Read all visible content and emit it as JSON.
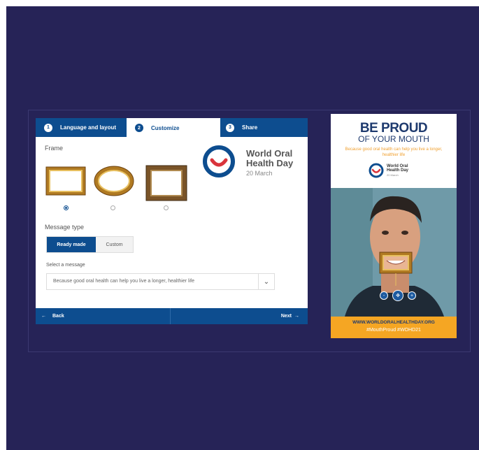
{
  "steps": [
    {
      "num": "1",
      "label": "Language and layout"
    },
    {
      "num": "2",
      "label": "Customize"
    },
    {
      "num": "3",
      "label": "Share"
    }
  ],
  "active_step": "Customize",
  "frame_section": {
    "label": "Frame",
    "options": [
      "rectangle-gold-frame",
      "oval-gold-frame",
      "square-bronze-frame"
    ],
    "selected_index": 0
  },
  "brand": {
    "title": "World Oral Health Day",
    "date": "20 March",
    "accent": "#0d4d8f",
    "logo_red": "#d9343c"
  },
  "message": {
    "type_label": "Message type",
    "options": [
      "Ready made",
      "Custom"
    ],
    "selected": "Ready made",
    "select_label": "Select a message",
    "selected_message": "Because good oral health can help you live a longer, healthier life"
  },
  "nav": {
    "back": "Back",
    "next": "Next"
  },
  "poster": {
    "headline_1": "BE PROUD",
    "headline_2": "OF YOUR MOUTH",
    "tagline": "Because good oral health can help you live a longer, healthier life",
    "logo_title": "World Oral Health Day",
    "logo_date": "20 March",
    "url": "WWW.WORLDORALHEALTHDAY.ORG",
    "hashtags": "#MouthProud #WOHD21",
    "controls": [
      "-",
      "move",
      "+"
    ]
  }
}
